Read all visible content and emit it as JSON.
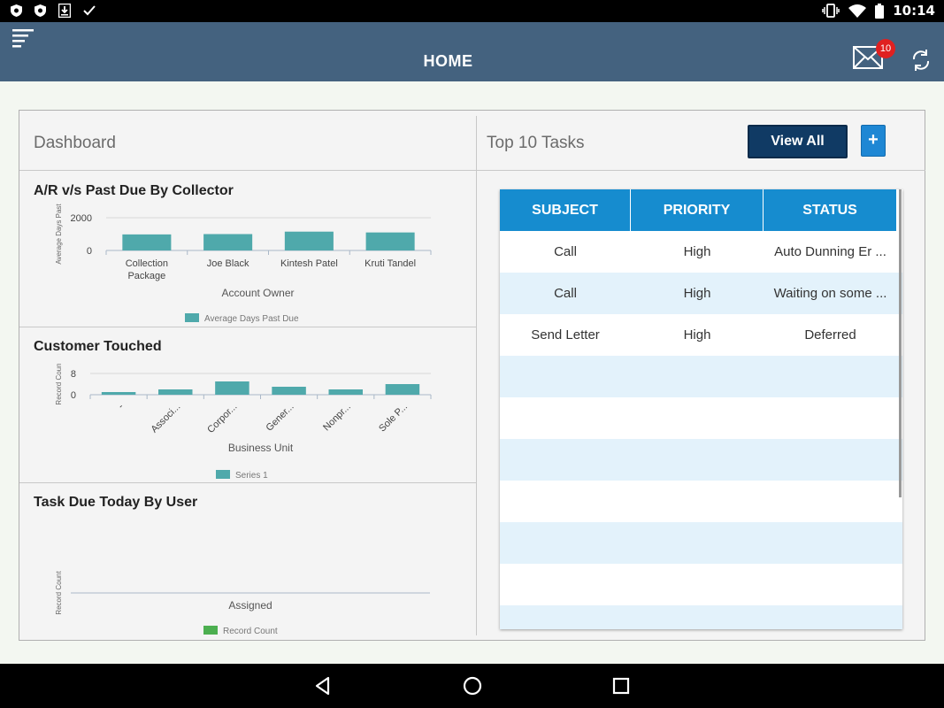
{
  "status_bar": {
    "time": "10:14",
    "left_icons": [
      "shield-icon",
      "shield-icon",
      "download-icon",
      "check-icon"
    ],
    "right_icons": [
      "vibrate-icon",
      "wifi-icon",
      "battery-icon"
    ]
  },
  "app_bar": {
    "title": "HOME",
    "mail_badge": "10",
    "icons": [
      "menu-icon",
      "mail-icon",
      "sync-icon"
    ],
    "color": "#44627f"
  },
  "dashboard": {
    "title": "Dashboard",
    "charts": [
      {
        "title": "A/R v/s Past Due By Collector",
        "ylabel": "Average Days Past",
        "xlabel": "Account Owner",
        "legend": "Average Days Past Due",
        "y_ticks": [
          "2000",
          "0"
        ]
      },
      {
        "title": "Customer Touched",
        "ylabel": "Record Coun",
        "xlabel": "Business Unit",
        "legend": "Series 1",
        "y_ticks": [
          "8",
          "0"
        ]
      },
      {
        "title": "Task Due Today By User",
        "ylabel": "Record Count",
        "xlabel": "Assigned",
        "legend": "Record Count"
      }
    ]
  },
  "chart_data": [
    {
      "type": "bar",
      "title": "A/R v/s Past Due By Collector",
      "categories": [
        "Collection Package",
        "Joe Black",
        "Kintesh Patel",
        "Kruti Tandel"
      ],
      "values": [
        980,
        1000,
        1150,
        1100
      ],
      "ylim": [
        0,
        2000
      ],
      "xlabel": "Account Owner",
      "ylabel": "Average Days Past",
      "series": [
        {
          "name": "Average Days Past Due",
          "values": [
            980,
            1000,
            1150,
            1100
          ]
        }
      ],
      "color": "#4fa9ab",
      "legend": "bottom-center"
    },
    {
      "type": "bar",
      "title": "Customer Touched",
      "categories": [
        "-",
        "Associ...",
        "Corpor...",
        "Gener...",
        "Nonpr...",
        "Sole P..."
      ],
      "values": [
        1,
        2,
        5,
        3,
        2,
        4
      ],
      "ylim": [
        0,
        8
      ],
      "xlabel": "Business Unit",
      "ylabel": "Record Coun",
      "series": [
        {
          "name": "Series 1",
          "values": [
            1,
            2,
            5,
            3,
            2,
            4
          ]
        }
      ],
      "color": "#4fa9ab",
      "legend": "bottom-center"
    },
    {
      "type": "bar",
      "title": "Task Due Today By User",
      "categories": [],
      "values": [],
      "xlabel": "Assigned",
      "ylabel": "Record Count",
      "series": [
        {
          "name": "Record Count",
          "values": []
        }
      ],
      "color": "#4caf50",
      "legend": "bottom-center"
    }
  ],
  "tasks": {
    "title": "Top 10 Tasks",
    "view_all": "View All",
    "add": "+",
    "columns": [
      "SUBJECT",
      "PRIORITY",
      "STATUS"
    ],
    "rows": [
      [
        "Call",
        "High",
        "Auto Dunning Er ..."
      ],
      [
        "Call",
        "High",
        "Waiting on some ..."
      ],
      [
        "Send Letter",
        "High",
        "Deferred"
      ],
      [
        "",
        "",
        ""
      ],
      [
        "",
        "",
        ""
      ],
      [
        "",
        "",
        ""
      ],
      [
        "",
        "",
        ""
      ],
      [
        "",
        "",
        ""
      ],
      [
        "",
        "",
        ""
      ],
      [
        "",
        "",
        ""
      ]
    ]
  },
  "nav_bar": {
    "icons": [
      "back-icon",
      "home-icon",
      "recents-icon"
    ]
  }
}
